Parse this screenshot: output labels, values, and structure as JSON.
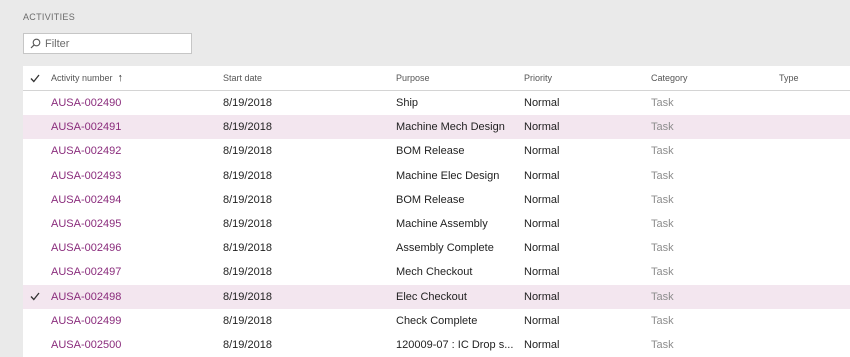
{
  "section": {
    "title": "ACTIVITIES"
  },
  "filter": {
    "placeholder": "Filter",
    "icon": "search-icon"
  },
  "grid": {
    "columns": {
      "activity_number": "Activity number",
      "start_date": "Start date",
      "purpose": "Purpose",
      "priority": "Priority",
      "category": "Category",
      "type": "Type"
    },
    "sort": {
      "column": "activity_number",
      "direction": "ascending"
    },
    "rows": [
      {
        "number": "AUSA-002490",
        "start": "8/19/2018",
        "purpose": "Ship",
        "priority": "Normal",
        "category": "Task",
        "type": "",
        "checked": false,
        "selected": false
      },
      {
        "number": "AUSA-002491",
        "start": "8/19/2018",
        "purpose": "Machine Mech Design",
        "priority": "Normal",
        "category": "Task",
        "type": "",
        "checked": false,
        "selected": true
      },
      {
        "number": "AUSA-002492",
        "start": "8/19/2018",
        "purpose": "BOM Release",
        "priority": "Normal",
        "category": "Task",
        "type": "",
        "checked": false,
        "selected": false
      },
      {
        "number": "AUSA-002493",
        "start": "8/19/2018",
        "purpose": "Machine Elec Design",
        "priority": "Normal",
        "category": "Task",
        "type": "",
        "checked": false,
        "selected": false
      },
      {
        "number": "AUSA-002494",
        "start": "8/19/2018",
        "purpose": "BOM Release",
        "priority": "Normal",
        "category": "Task",
        "type": "",
        "checked": false,
        "selected": false
      },
      {
        "number": "AUSA-002495",
        "start": "8/19/2018",
        "purpose": "Machine Assembly",
        "priority": "Normal",
        "category": "Task",
        "type": "",
        "checked": false,
        "selected": false
      },
      {
        "number": "AUSA-002496",
        "start": "8/19/2018",
        "purpose": "Assembly Complete",
        "priority": "Normal",
        "category": "Task",
        "type": "",
        "checked": false,
        "selected": false
      },
      {
        "number": "AUSA-002497",
        "start": "8/19/2018",
        "purpose": "Mech Checkout",
        "priority": "Normal",
        "category": "Task",
        "type": "",
        "checked": false,
        "selected": false
      },
      {
        "number": "AUSA-002498",
        "start": "8/19/2018",
        "purpose": "Elec Checkout",
        "priority": "Normal",
        "category": "Task",
        "type": "",
        "checked": true,
        "selected": true
      },
      {
        "number": "AUSA-002499",
        "start": "8/19/2018",
        "purpose": "Check Complete",
        "priority": "Normal",
        "category": "Task",
        "type": "",
        "checked": false,
        "selected": false
      },
      {
        "number": "AUSA-002500",
        "start": "8/19/2018",
        "purpose": "120009-07 : IC Drop s...",
        "priority": "Normal",
        "category": "Task",
        "type": "",
        "checked": false,
        "selected": false
      }
    ]
  },
  "colors": {
    "link": "#8a2c7c",
    "selected_row": "#f3e6ef",
    "background": "#eaeaea"
  }
}
